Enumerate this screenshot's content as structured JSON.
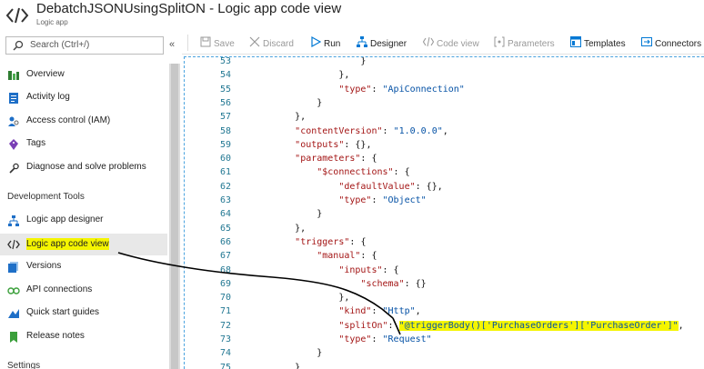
{
  "header": {
    "title": "DebatchJSONUsingSplitON - Logic app code view",
    "subtitle": "Logic app",
    "icon": "code-brackets-icon"
  },
  "sidebar": {
    "search_placeholder": "Search (Ctrl+/)",
    "collapse_label": "«",
    "items_top": [
      {
        "label": "Overview",
        "icon": "overview-icon"
      },
      {
        "label": "Activity log",
        "icon": "activity-log-icon"
      },
      {
        "label": "Access control (IAM)",
        "icon": "access-control-icon"
      },
      {
        "label": "Tags",
        "icon": "tag-icon"
      },
      {
        "label": "Diagnose and solve problems",
        "icon": "wrench-icon"
      }
    ],
    "section_dev": "Development Tools",
    "items_dev": [
      {
        "label": "Logic app designer",
        "icon": "designer-icon"
      },
      {
        "label": "Logic app code view",
        "icon": "code-view-icon",
        "active": true
      },
      {
        "label": "Versions",
        "icon": "versions-icon"
      },
      {
        "label": "API connections",
        "icon": "api-connections-icon"
      },
      {
        "label": "Quick start guides",
        "icon": "quickstart-icon"
      },
      {
        "label": "Release notes",
        "icon": "release-notes-icon"
      }
    ],
    "section_settings": "Settings"
  },
  "toolbar": {
    "save": "Save",
    "discard": "Discard",
    "run": "Run",
    "designer": "Designer",
    "code_view": "Code view",
    "parameters": "Parameters",
    "templates": "Templates",
    "connectors": "Connectors"
  },
  "editor": {
    "lines": [
      {
        "n": "53",
        "text": "                    }"
      },
      {
        "n": "54",
        "text": "                },"
      },
      {
        "n": "55",
        "text": "                \"type\": \"ApiConnection\""
      },
      {
        "n": "56",
        "text": "            }"
      },
      {
        "n": "57",
        "text": "        },"
      },
      {
        "n": "58",
        "text": "        \"contentVersion\": \"1.0.0.0\","
      },
      {
        "n": "59",
        "text": "        \"outputs\": {},"
      },
      {
        "n": "60",
        "text": "        \"parameters\": {"
      },
      {
        "n": "61",
        "text": "            \"$connections\": {"
      },
      {
        "n": "62",
        "text": "                \"defaultValue\": {},"
      },
      {
        "n": "63",
        "text": "                \"type\": \"Object\""
      },
      {
        "n": "64",
        "text": "            }"
      },
      {
        "n": "65",
        "text": "        },"
      },
      {
        "n": "66",
        "text": "        \"triggers\": {"
      },
      {
        "n": "67",
        "text": "            \"manual\": {"
      },
      {
        "n": "68",
        "text": "                \"inputs\": {"
      },
      {
        "n": "69",
        "text": "                    \"schema\": {}"
      },
      {
        "n": "70",
        "text": "                },"
      },
      {
        "n": "71",
        "text": "                \"kind\": \"Http\","
      },
      {
        "n": "72",
        "text": "                \"splitOn\": \"@triggerBody()['PurchaseOrders']['PurchaseOrder']\","
      },
      {
        "n": "73",
        "text": "                \"type\": \"Request\""
      },
      {
        "n": "74",
        "text": "            }"
      },
      {
        "n": "75",
        "text": "        }"
      }
    ]
  },
  "colors": {
    "highlight": "#f5f500",
    "json_key": "#a31515",
    "json_string": "#0451a5",
    "line_number": "#237893",
    "accent": "#0078d4"
  }
}
